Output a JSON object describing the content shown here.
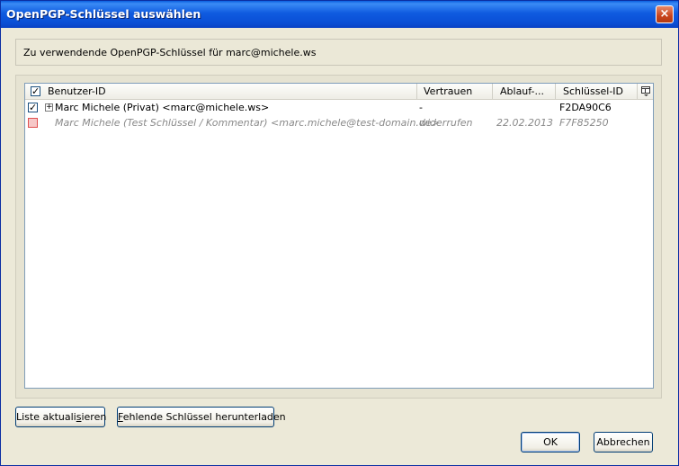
{
  "window": {
    "title": "OpenPGP-Schlüssel auswählen",
    "close_glyph": "×"
  },
  "header": {
    "text": "Zu verwendende OpenPGP-Schlüssel für marc@michele.ws"
  },
  "tree": {
    "columns": {
      "user_id": "Benutzer-ID",
      "trust": "Vertrauen",
      "expiry": "Ablauf-...",
      "key_id": "Schlüssel-ID",
      "picker_icon": "column-picker-icon"
    },
    "rows": [
      {
        "checked": true,
        "expander": "+",
        "user_id": "Marc Michele (Privat) <marc@michele.ws>",
        "trust": "-",
        "expiry": "",
        "key_id": "F2DA90C6"
      },
      {
        "checked": false,
        "user_id": "Marc Michele (Test Schlüssel / Kommentar) <marc.michele@test-domain.de>",
        "trust": "widerrufen",
        "expiry": "22.02.2013",
        "key_id": "F7F85250"
      }
    ]
  },
  "buttons": {
    "refresh_pre": "Liste aktuali",
    "refresh_key": "s",
    "refresh_post": "ieren",
    "download_key": "F",
    "download_post": "ehlende Schlüssel herunterladen",
    "ok": "OK",
    "cancel": "Abbrechen"
  }
}
